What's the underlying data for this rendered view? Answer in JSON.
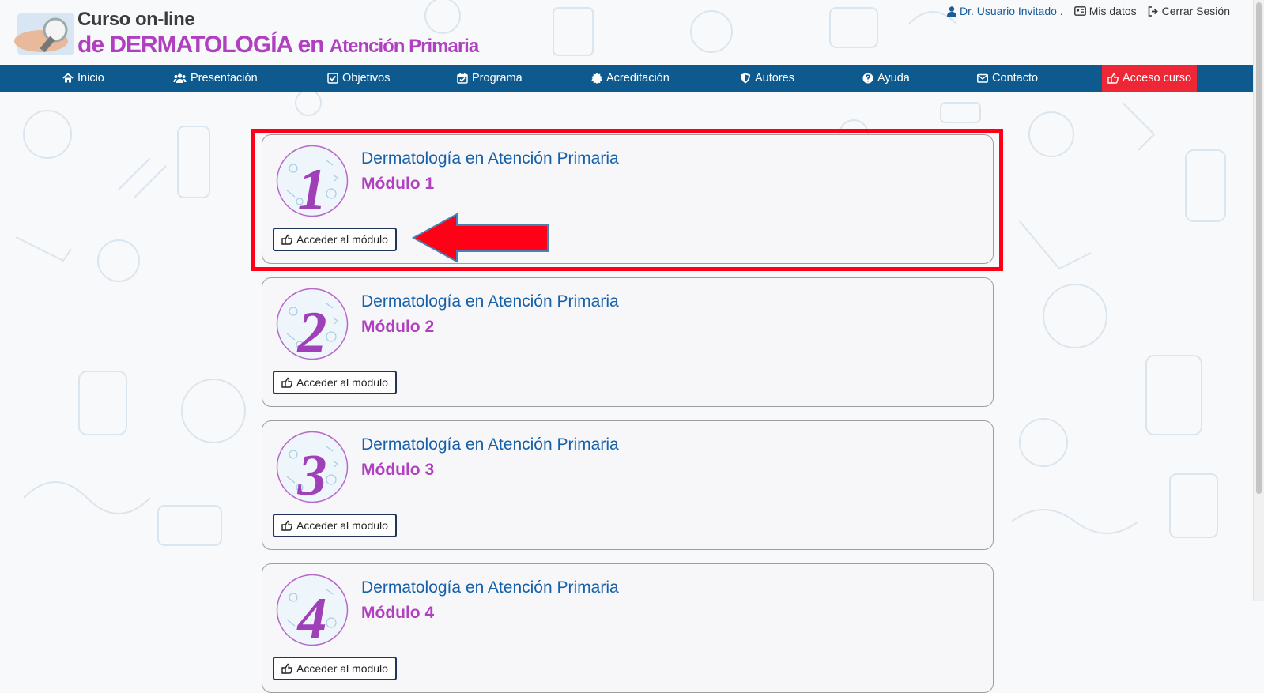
{
  "header": {
    "logo_line1": "Curso  on-line",
    "logo_line2_main": "de DERMATOLOGÍA en ",
    "logo_line2_sub": "Atención Primaria",
    "user_name": "Dr. Usuario Invitado .",
    "my_data": "Mis datos",
    "logout": "Cerrar Sesión"
  },
  "nav": {
    "items": [
      {
        "label": "Inicio",
        "icon": "home-icon"
      },
      {
        "label": "Presentación",
        "icon": "users-icon"
      },
      {
        "label": "Objetivos",
        "icon": "checkbox-icon"
      },
      {
        "label": "Programa",
        "icon": "calendar-check-icon"
      },
      {
        "label": "Acreditación",
        "icon": "certificate-icon"
      },
      {
        "label": "Autores",
        "icon": "shield-icon"
      },
      {
        "label": "Ayuda",
        "icon": "question-icon"
      },
      {
        "label": "Contacto",
        "icon": "envelope-icon"
      },
      {
        "label": "Acceso curso",
        "icon": "hand-pointer-icon"
      }
    ]
  },
  "modules": [
    {
      "number": "1",
      "title": "Dermatología en Atención Primaria",
      "name": "Módulo 1",
      "button": "Acceder al módulo"
    },
    {
      "number": "2",
      "title": "Dermatología en Atención Primaria",
      "name": "Módulo 2",
      "button": "Acceder al módulo"
    },
    {
      "number": "3",
      "title": "Dermatología en Atención Primaria",
      "name": "Módulo 3",
      "button": "Acceder al módulo"
    },
    {
      "number": "4",
      "title": "Dermatología en Atención Primaria",
      "name": "Módulo 4",
      "button": "Acceder al módulo"
    }
  ],
  "colors": {
    "nav_bg": "#0e5a8e",
    "accent_red": "#ee2737",
    "title_blue": "#1560a8",
    "module_purple": "#b040c0",
    "highlight_red": "#ff0016"
  }
}
